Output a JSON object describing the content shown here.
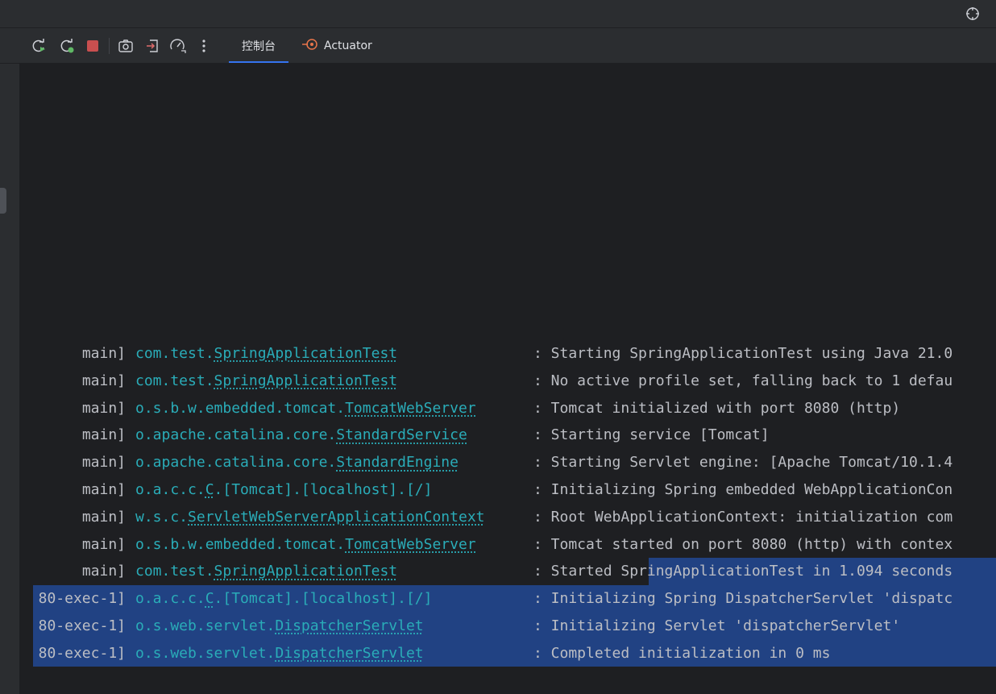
{
  "toolbar": {
    "buttons": [
      {
        "name": "rerun-icon"
      },
      {
        "name": "rerun-failed-icon"
      },
      {
        "name": "stop-icon"
      },
      {
        "name": "screenshot-icon"
      },
      {
        "name": "exit-icon"
      },
      {
        "name": "performance-icon"
      },
      {
        "name": "more-icon"
      }
    ],
    "tabs": [
      {
        "label": "控制台",
        "active": true
      },
      {
        "label": "Actuator",
        "icon": "actuator-icon",
        "active": false
      }
    ]
  },
  "console": {
    "lines": [
      {
        "thread": "main]",
        "logger_prefix": "com.test.",
        "logger_class": "SpringApplicationTest",
        "logger_suffix": "",
        "message": ": Starting SpringApplicationTest using Java 21.0"
      },
      {
        "thread": "main]",
        "logger_prefix": "com.test.",
        "logger_class": "SpringApplicationTest",
        "logger_suffix": "",
        "message": ": No active profile set, falling back to 1 defau"
      },
      {
        "thread": "main]",
        "logger_prefix": "o.s.b.w.embedded.tomcat.",
        "logger_class": "TomcatWebServer",
        "logger_suffix": "",
        "message": ": Tomcat initialized with port 8080 (http)"
      },
      {
        "thread": "main]",
        "logger_prefix": "o.apache.catalina.core.",
        "logger_class": "StandardService",
        "logger_suffix": "",
        "message": ": Starting service [Tomcat]"
      },
      {
        "thread": "main]",
        "logger_prefix": "o.apache.catalina.core.",
        "logger_class": "StandardEngine",
        "logger_suffix": "",
        "message": ": Starting Servlet engine: [Apache Tomcat/10.1.4"
      },
      {
        "thread": "main]",
        "logger_prefix": "o.a.c.c.",
        "logger_class": "C",
        "logger_suffix": ".[Tomcat].[localhost].[/]",
        "message": ": Initializing Spring embedded WebApplicationCon"
      },
      {
        "thread": "main]",
        "logger_prefix": "w.s.c.",
        "logger_class": "ServletWebServerApplicationContext",
        "logger_suffix": "",
        "message": ": Root WebApplicationContext: initialization com"
      },
      {
        "thread": "main]",
        "logger_prefix": "o.s.b.w.embedded.tomcat.",
        "logger_class": "TomcatWebServer",
        "logger_suffix": "",
        "message": ": Tomcat started on port 8080 (http) with contex"
      },
      {
        "thread": "main]",
        "logger_prefix": "com.test.",
        "logger_class": "SpringApplicationTest",
        "logger_suffix": "",
        "message": ": Started SpringApplicationTest in 1.094 seconds"
      },
      {
        "thread": "80-exec-1]",
        "logger_prefix": "o.a.c.c.",
        "logger_class": "C",
        "logger_suffix": ".[Tomcat].[localhost].[/]",
        "message": ": Initializing Spring DispatcherServlet 'dispatc"
      },
      {
        "thread": "80-exec-1]",
        "logger_prefix": "o.s.web.servlet.",
        "logger_class": "DispatcherServlet",
        "logger_suffix": "",
        "message": ": Initializing Servlet 'dispatcherServlet'"
      },
      {
        "thread": "80-exec-1]",
        "logger_prefix": "o.s.web.servlet.",
        "logger_class": "DispatcherServlet",
        "logger_suffix": "",
        "message": ": Completed initialization in 0 ms"
      }
    ]
  },
  "colors": {
    "background": "#1e1f22",
    "panel": "#2b2d30",
    "logger": "#2aacb8",
    "text": "#bcbec4",
    "selection": "#214283",
    "accent": "#3574f0",
    "stop": "#c94f4f"
  }
}
